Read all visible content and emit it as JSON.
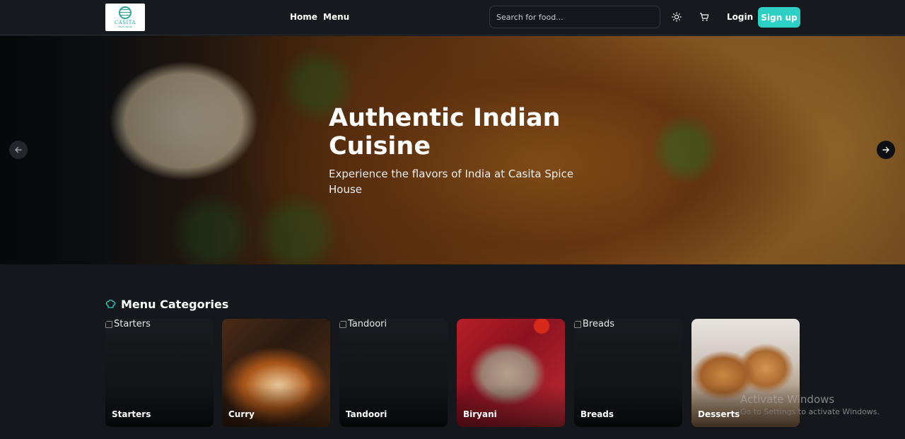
{
  "brand": {
    "logo_text": "CASITA",
    "logo_sub": "SPICE HOUSE"
  },
  "nav": {
    "home": "Home",
    "menu": "Menu"
  },
  "search": {
    "placeholder": "Search for food..."
  },
  "auth": {
    "login": "Login",
    "signup": "Sign up"
  },
  "hero": {
    "title": "Authentic Indian Cuisine",
    "subtitle": "Experience the flavors of India at Casita Spice House"
  },
  "categories": {
    "heading": "Menu Categories",
    "items": [
      {
        "label": "Starters",
        "alt": "Starters"
      },
      {
        "label": "Curry",
        "alt": ""
      },
      {
        "label": "Tandoori",
        "alt": "Tandoori"
      },
      {
        "label": "Biryani",
        "alt": ""
      },
      {
        "label": "Breads",
        "alt": "Breads"
      },
      {
        "label": "Desserts",
        "alt": ""
      }
    ]
  },
  "watermark": {
    "line1": "Activate Windows",
    "line2": "Go to Settings to activate Windows."
  },
  "colors": {
    "accent": "#2dd0c4",
    "background": "#14171b"
  }
}
